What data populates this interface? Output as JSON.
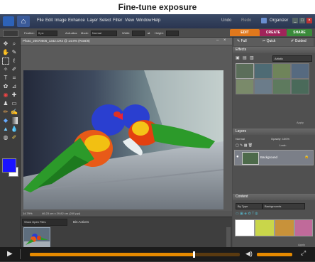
{
  "banner": {
    "title": "Fine-tune exposure"
  },
  "menubar": {
    "items": [
      "File",
      "Edit",
      "Image",
      "Enhance",
      "Layer",
      "Select",
      "Filter",
      "View",
      "Window",
      "Help"
    ],
    "undo": "Undo",
    "redo": "Redo",
    "organizer": "Organizer"
  },
  "options": {
    "feather_label": "Feather:",
    "feather_value": "0 px",
    "antialias": "Anti-alias",
    "mode_label": "Mode:",
    "mode_value": "Normal",
    "width_label": "Width:",
    "height_label": "Height:"
  },
  "mode_tabs": {
    "edit": "EDIT",
    "create": "CREATE",
    "share": "SHARE"
  },
  "subtabs": {
    "full": "Full",
    "quick": "Quick",
    "guided": "Guided"
  },
  "document": {
    "title": "Photo_20070606_1342.CR2 @ 14.8% (RGB/8)",
    "status": "14.79%",
    "dims": "46.23 cm x 29.82 cm (240 ppi)"
  },
  "bin": {
    "show_label": "Show Open Files",
    "actions_label": "Bin Actions",
    "hide_label": "Hide Project Bin"
  },
  "effects": {
    "title": "Effects",
    "filter": "Artistic",
    "apply": "Apply"
  },
  "layers": {
    "title": "Layers",
    "normal": "Normal",
    "opacity": "Opacity: 100%",
    "lock": "Lock:",
    "layer_name": "Background"
  },
  "content": {
    "title": "Content",
    "by_type": "By Type",
    "backgrounds": "Backgrounds",
    "apply": "Apply"
  },
  "palette_bin": "Palette Bin",
  "colors": {
    "foreground": "#1a13ff",
    "background": "#ffffff",
    "accent": "#e67800",
    "create_tab": "#a0245a",
    "share_tab": "#3a8a3a",
    "edit_tab": "#e0781c"
  },
  "timeline": {
    "progress": 0.78
  }
}
